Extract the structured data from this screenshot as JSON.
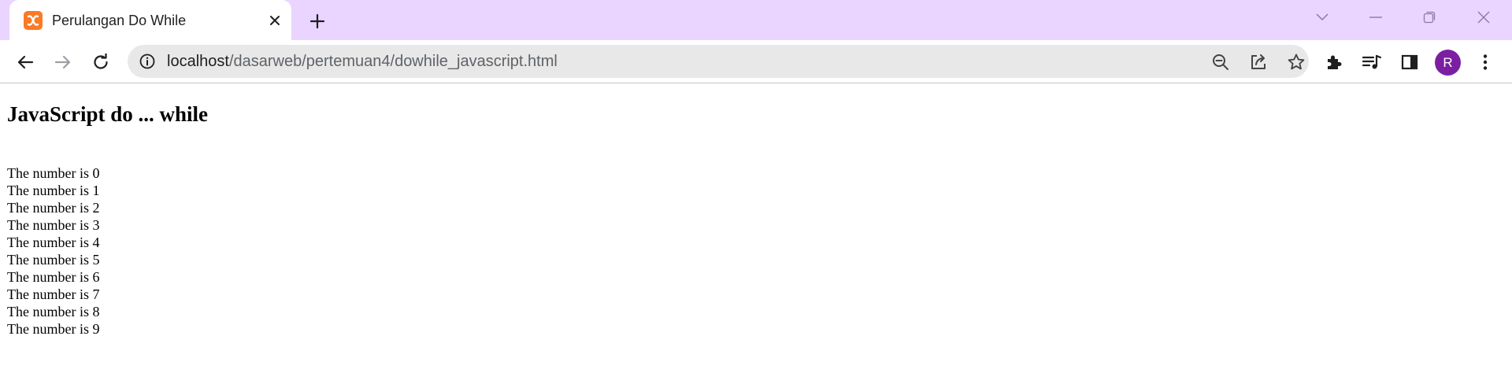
{
  "tab": {
    "title": "Perulangan Do While",
    "favicon": "xampp-icon",
    "close_icon": "close-icon"
  },
  "new_tab_icon": "plus-icon",
  "window_controls": [
    "tab-search-icon",
    "minimize-icon",
    "restore-icon",
    "close-window-icon"
  ],
  "toolbar": {
    "back_icon": "back-arrow-icon",
    "forward_icon": "forward-arrow-icon",
    "reload_icon": "reload-icon",
    "url_host": "localhost",
    "url_path": "/dasarweb/pertemuan4/dowhile_javascript.html",
    "omnibox_icons": [
      "zoom-out-icon",
      "share-icon",
      "bookmark-star-icon"
    ],
    "right_icons": [
      "extensions-icon",
      "media-control-icon",
      "side-panel-icon"
    ],
    "avatar_letter": "R",
    "menu_icon": "kebab-menu-icon"
  },
  "colors": {
    "tabstrip_bg": "#e9d5ff",
    "favicon_bg": "#fb7a24",
    "avatar_bg": "#7b1fa2",
    "omnibox_bg": "#e8e8e8"
  },
  "page": {
    "heading": "JavaScript do ... while",
    "output_lines": [
      "The number is 0",
      "The number is 1",
      "The number is 2",
      "The number is 3",
      "The number is 4",
      "The number is 5",
      "The number is 6",
      "The number is 7",
      "The number is 8",
      "The number is 9"
    ]
  }
}
